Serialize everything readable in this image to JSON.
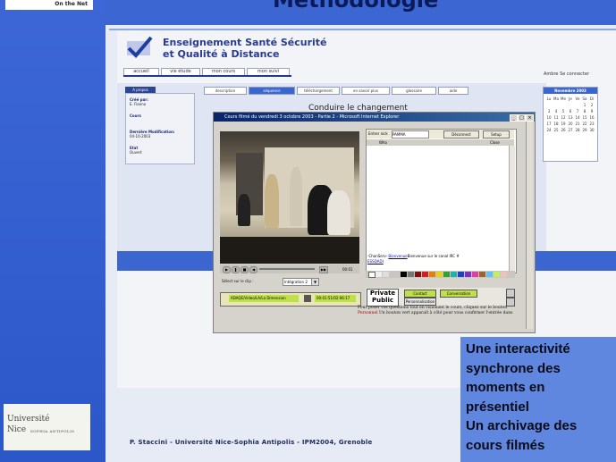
{
  "slide": {
    "title": "Méthodologie",
    "on_the_net": "On the Net",
    "footer": "P. Staccini - Université Nice-Sophia Antipolis - IPM2004, Grenoble",
    "university_logo": [
      "Université",
      "Nice",
      "SOPHIA ANTIPOLIS"
    ],
    "callout": [
      "Une interactivité",
      "synchrone des",
      "moments en",
      "présentiel",
      "Un archivage des",
      "cours filmés"
    ]
  },
  "site": {
    "title_line1": "Enseignement Santé Sécurité",
    "title_line2": "et Qualité à Distance",
    "nav_tabs": [
      "accueil",
      "vie étude",
      "mon cours",
      "mon suivi"
    ],
    "login": [
      "Ambre",
      "Se connecter"
    ],
    "left_tab": "A propos",
    "left_panel": [
      {
        "label": "Créé par:",
        "value": "E. Fianno"
      },
      {
        "label": "Cours",
        "value": ""
      },
      {
        "label": "Dernière Modification:",
        "value": "04-10-2003"
      },
      {
        "label": "Etat",
        "value": "Ouvert"
      }
    ],
    "content_tabs": [
      "description",
      "séquence",
      "téléchargement",
      "en savoir plus",
      "glossaire",
      "aide"
    ],
    "section_title": "Conduire le changement"
  },
  "calendar": {
    "month": "Novembre 2003",
    "days": [
      "Lu",
      "Ma",
      "Me",
      "Je",
      "Ve",
      "Sa",
      "Di"
    ],
    "dates": [
      "",
      "",
      "",
      "",
      "",
      "1",
      "2",
      "3",
      "4",
      "5",
      "6",
      "7",
      "8",
      "9",
      "10",
      "11",
      "12",
      "13",
      "14",
      "15",
      "16",
      "17",
      "18",
      "19",
      "20",
      "21",
      "22",
      "23",
      "24",
      "25",
      "26",
      "27",
      "28",
      "29",
      "30"
    ]
  },
  "popup": {
    "title": "Cours filmé du vendredi 3 octobre 2003 - Partie 2 - Microsoft Internet Explorer",
    "player": {
      "clip_label": "Sélect sur le clip :",
      "clip_value": "Intégration 2",
      "green_label": "ADAQE/Video/LA/La Dimension",
      "time": "00:01:51/02:06:17",
      "duration": "00:01"
    },
    "chat": {
      "input_label": "Entrer nick",
      "input_value": "PAMMA",
      "connect_label": "Déconnect",
      "setup_label": "Setup",
      "head_left": "Who",
      "head_right": "Close",
      "message_name": "Bienvenue",
      "message_text": "Bienvenue sur le canal IRC # ",
      "message_prefix": "-ChanServ- ",
      "message_link": "ESSQADI"
    },
    "private_label": "Private Public",
    "buttons": [
      "Contact",
      "Conversation",
      "Personnalisation"
    ],
    "instructions_part1": "Pour poser vos questions tout en visionant le cours, cliquez sur le bouton ",
    "instructions_red": "Personnel",
    "instructions_part2": " Un bouton vert apparaît à côté pour vous confirmer l'entrée dans"
  },
  "colors": {
    "slide_blue": "#2a56c8",
    "callout_bg": "#5f87df",
    "titlebar": "#0a246a"
  }
}
